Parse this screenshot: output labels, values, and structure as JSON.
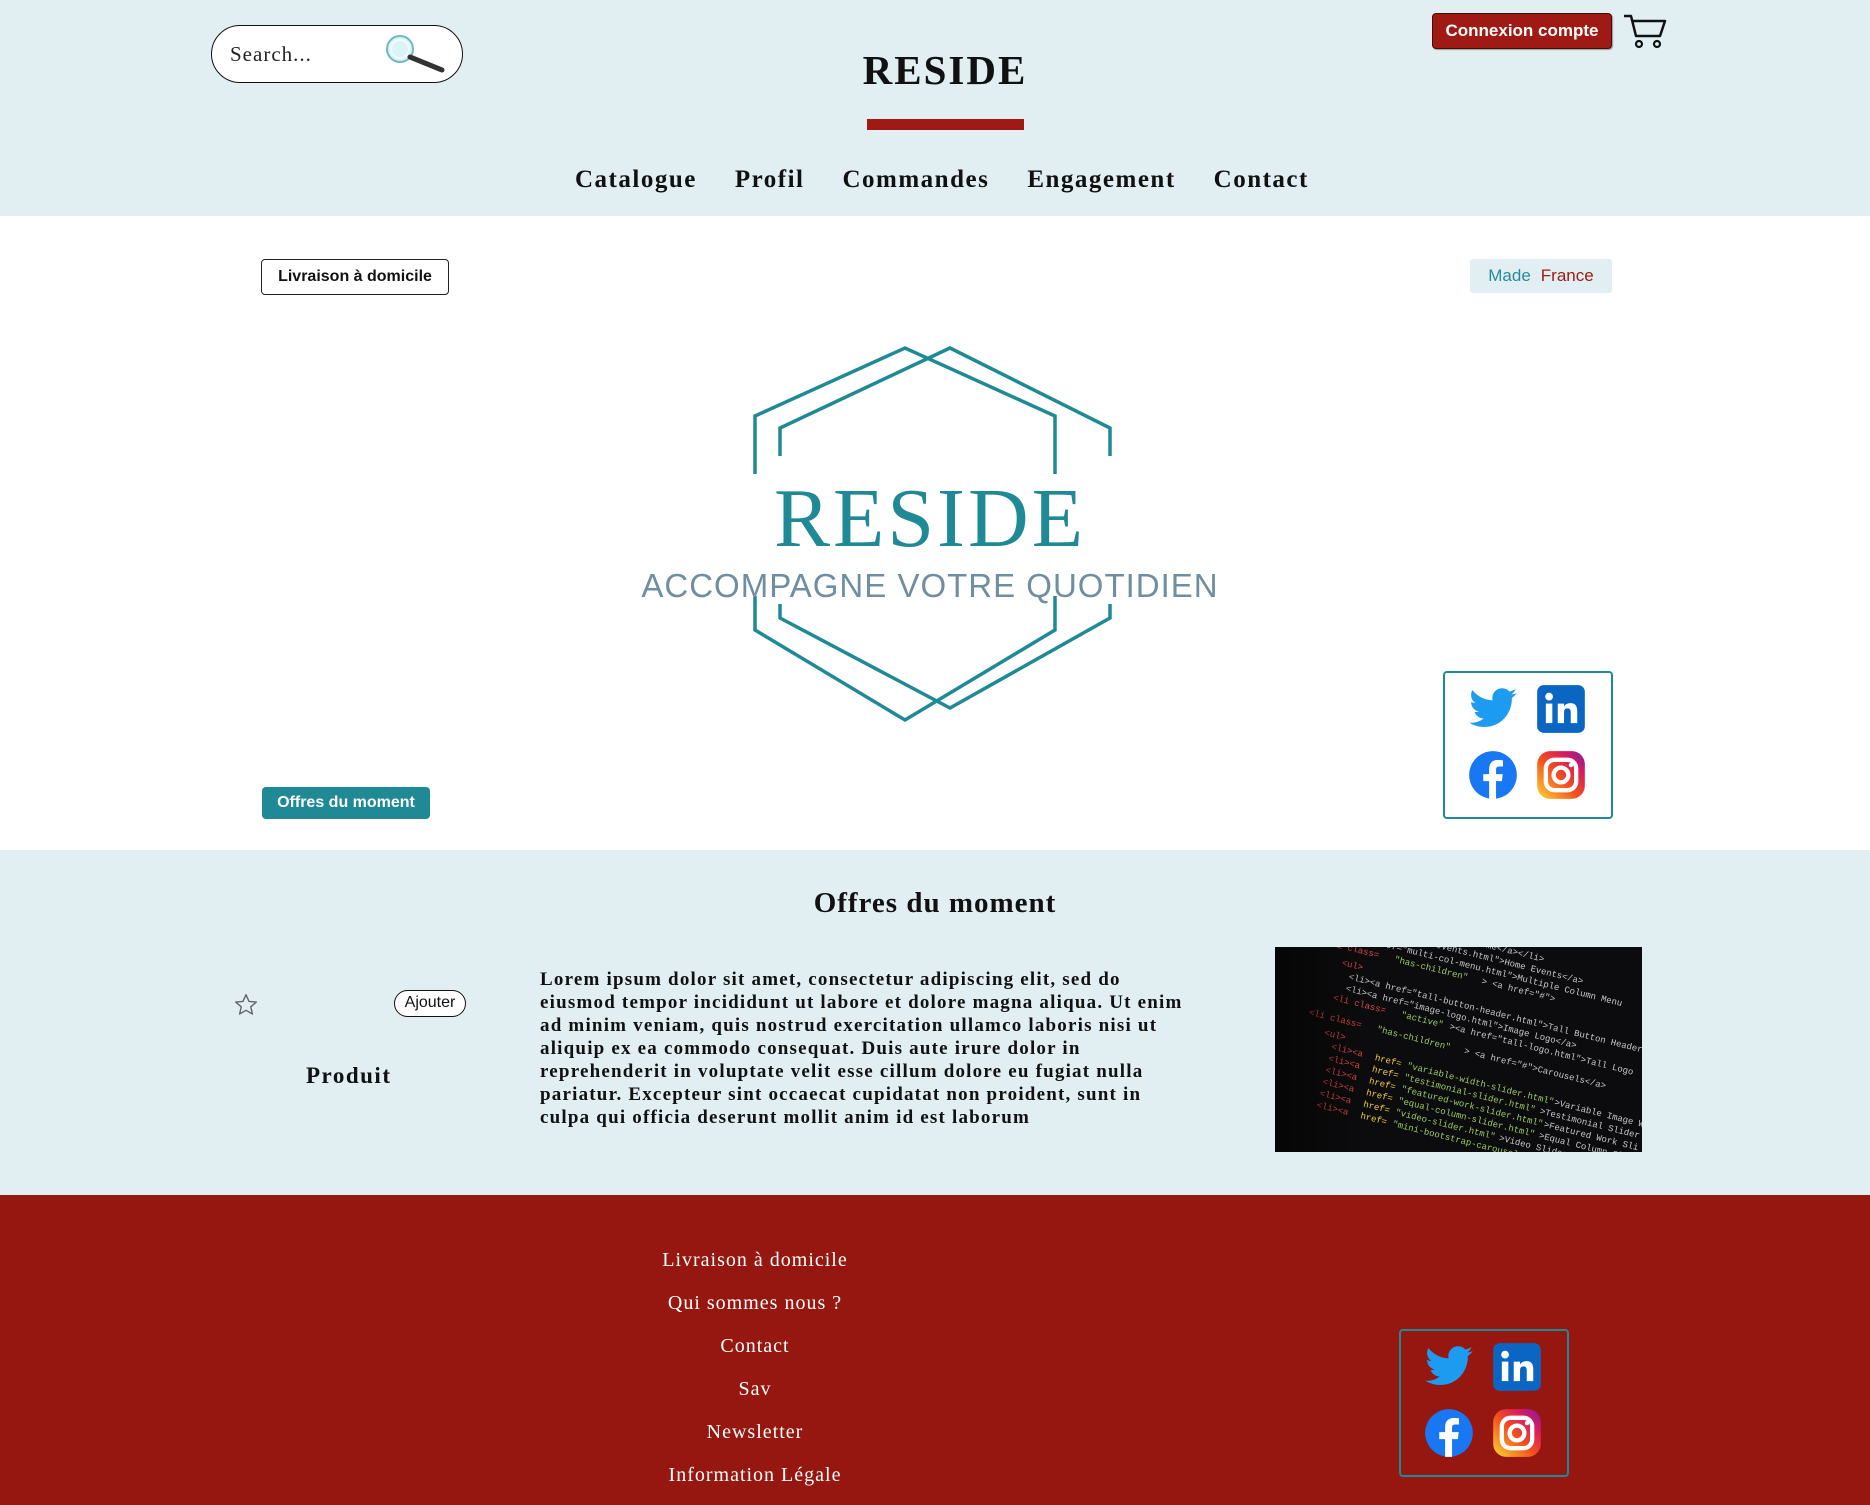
{
  "header": {
    "search_placeholder": "Search...",
    "brand": "RESIDE",
    "login_label": "Connexion compte",
    "nav": [
      "Catalogue",
      "Profil",
      "Commandes",
      "Engagement",
      "Contact"
    ]
  },
  "hero": {
    "livraison_label": "Livraison à domicile",
    "made_word1": "Made",
    "made_word2": "France",
    "logo_title": "RESIDE",
    "logo_tagline": "ACCOMPAGNE VOTRE QUOTIDIEN",
    "offres_label": "Offres du moment"
  },
  "offers": {
    "title": "Offres du moment",
    "add_label": "Ajouter",
    "product_label": "Produit",
    "description": "Lorem ipsum dolor sit amet, consectetur adipiscing elit, sed do eiusmod tempor incididunt ut labore et dolore magna aliqua. Ut enim ad minim veniam, quis nostrud exercitation ullamco laboris nisi ut aliquip ex ea commodo consequat. Duis aute irure dolor in reprehenderit in voluptate velit esse cillum dolore eu fugiat nulla pariatur. Excepteur sint occaecat cupidatat non proident, sunt in culpa qui officia deserunt mollit anim id est laborum"
  },
  "footer": {
    "links": [
      "Livraison à domicile",
      "Qui sommes nous ?",
      "Contact",
      "Sav",
      "Newsletter",
      "Information Légale"
    ]
  },
  "social_icons": [
    "twitter-icon",
    "linkedin-icon",
    "facebook-icon",
    "instagram-icon"
  ],
  "colors": {
    "header_bg": "#e1eff2",
    "brand_red": "#a01a15",
    "teal": "#1f8a96",
    "footer_bg": "#95170f"
  }
}
